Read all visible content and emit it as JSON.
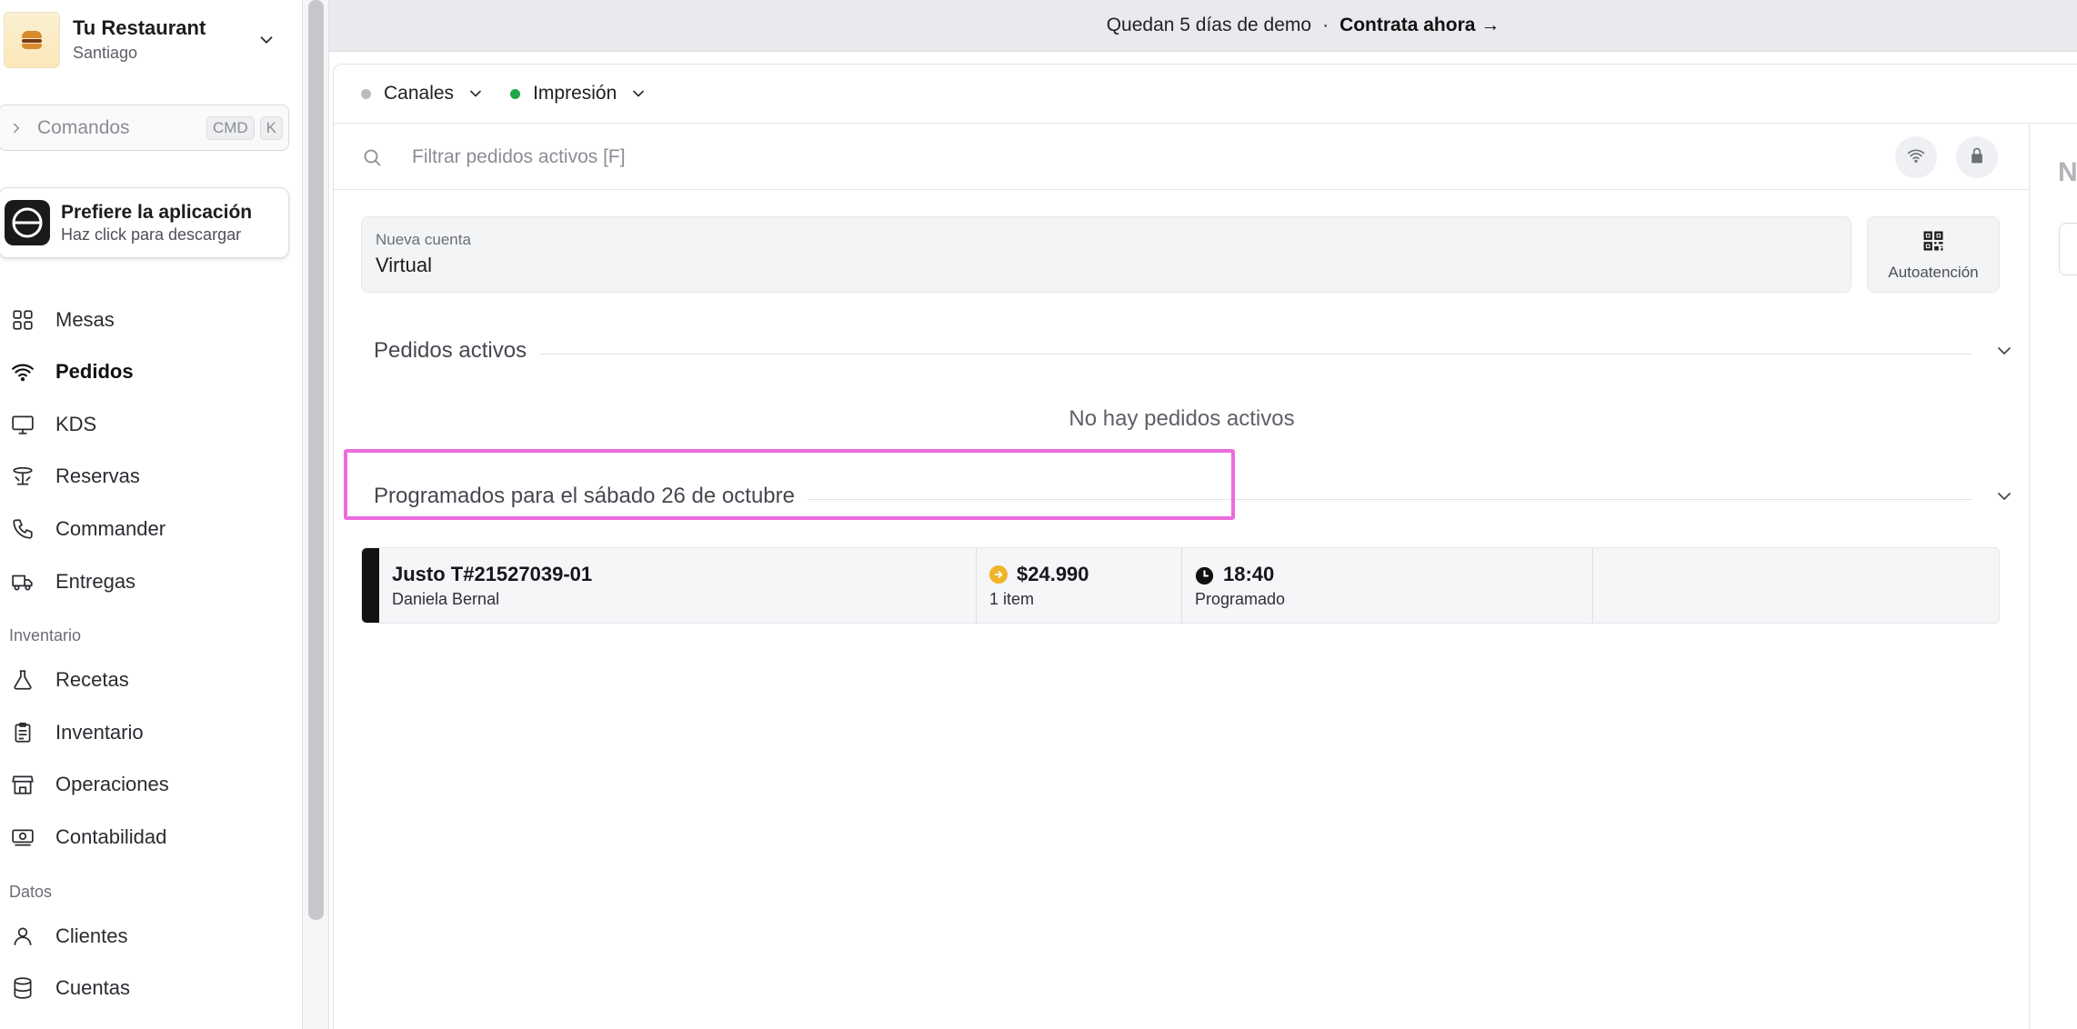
{
  "brand": {
    "name": "Tu Restaurant",
    "city": "Santiago"
  },
  "command": {
    "label": "Comandos",
    "kbd1": "CMD",
    "kbd2": "K"
  },
  "app_promo": {
    "title": "Prefiere la aplicación",
    "subtitle": "Haz click para descargar"
  },
  "nav": {
    "main": [
      {
        "label": "Mesas",
        "icon": "grid-icon"
      },
      {
        "label": "Pedidos",
        "icon": "wifi-icon",
        "active": true
      },
      {
        "label": "KDS",
        "icon": "monitor-icon"
      },
      {
        "label": "Reservas",
        "icon": "table-icon"
      },
      {
        "label": "Commander",
        "icon": "phone-icon"
      },
      {
        "label": "Entregas",
        "icon": "truck-icon"
      }
    ],
    "section_inventario": "Inventario",
    "inventario": [
      {
        "label": "Recetas",
        "icon": "flask-icon"
      },
      {
        "label": "Inventario",
        "icon": "clipboard-icon"
      },
      {
        "label": "Operaciones",
        "icon": "store-icon"
      },
      {
        "label": "Contabilidad",
        "icon": "cash-icon"
      }
    ],
    "section_datos": "Datos",
    "datos": [
      {
        "label": "Clientes",
        "icon": "user-icon"
      },
      {
        "label": "Cuentas",
        "icon": "database-icon"
      }
    ]
  },
  "banner": {
    "text": "Quedan 5 días de demo",
    "separator": "·",
    "cta": "Contrata ahora →"
  },
  "toolbar": {
    "channels": {
      "label": "Canales",
      "status_color": "#b9bbc0"
    },
    "printing": {
      "label": "Impresión",
      "status_color": "#1fa64a"
    }
  },
  "search": {
    "placeholder": "Filtrar pedidos activos [F]"
  },
  "new_account": {
    "caption": "Nueva cuenta",
    "value": "Virtual"
  },
  "autoatencion": {
    "label": "Autoatención"
  },
  "sections": {
    "active": {
      "title": "Pedidos activos",
      "empty": "No hay pedidos activos"
    },
    "scheduled": {
      "title": "Programados para el sábado 26 de octubre"
    }
  },
  "orders": [
    {
      "title": "Justo T#21527039-01",
      "customer": "Daniela Bernal",
      "amount": "$24.990",
      "items": "1 item",
      "time": "18:40",
      "status": "Programado"
    }
  ],
  "right_panel": {
    "peek_letter": "N"
  },
  "colors": {
    "highlight": "#ec6cdc",
    "accent_coin": "#f0b429",
    "status_green": "#1fa64a"
  }
}
